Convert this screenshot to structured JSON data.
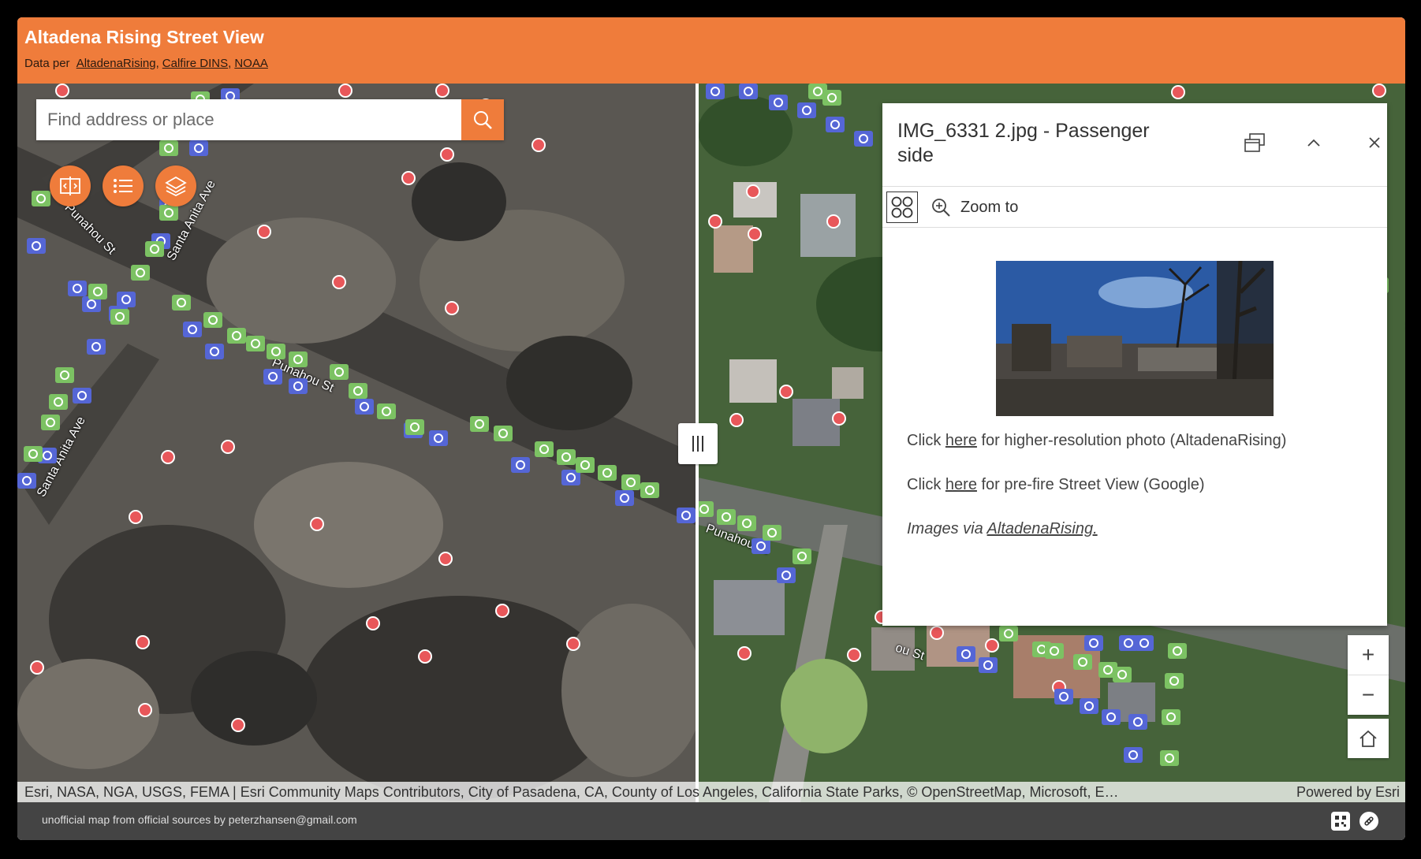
{
  "header": {
    "title": "Altadena Rising Street View",
    "credits_prefix": "Data per",
    "credit_links": [
      "AltadenaRising",
      "Calfire DINS",
      "NOAA"
    ]
  },
  "search": {
    "placeholder": "Find address or place",
    "button_icon": "search-icon"
  },
  "map_tools": [
    {
      "name": "swipe-tool-button",
      "icon": "swipe-icon"
    },
    {
      "name": "legend-button",
      "icon": "list-icon"
    },
    {
      "name": "layers-button",
      "icon": "layers-icon"
    }
  ],
  "road_labels": {
    "punahou_1": "Punahou St",
    "punahou_2": "Punahou St",
    "punahou_3": "Punahou St",
    "punahou_4": "ou St",
    "santa_anita_1": "Santa Anita Ave",
    "santa_anita_2": "Santa Anita Ave",
    "st_edge": "St"
  },
  "popup": {
    "title": "IMG_6331 2.jpg - Passenger side",
    "dock_icon": "dock-icon",
    "collapse_icon": "chevron-up-icon",
    "close_icon": "close-icon",
    "grid_icon": "grid-icon",
    "zoom_to_label": "Zoom to",
    "line1_prefix": "Click",
    "line1_link": "here",
    "line1_suffix": "for higher-resolution photo (AltadenaRising)",
    "line2_prefix": "Click",
    "line2_link": "here",
    "line2_suffix": "for pre-fire Street View (Google)",
    "line3_prefix": "Images via",
    "line3_link": "AltadenaRising."
  },
  "zoom": {
    "in": "+",
    "out": "−",
    "home_icon": "home-icon"
  },
  "attribution": {
    "text": "Esri, NASA, NGA, USGS, FEMA | Esri Community Maps Contributors, City of Pasadena, CA, County of Los Angeles, California State Parks, © OpenStreetMap, Microsoft, Esri, TomTom, Garmin, SafeGraph, GeoTechnologies, Inc, METI/NASA, USGS, Bureau of Land Management, EPA, NPS, US Census Bureau, USDA, USFWS",
    "powered": "Powered by Esri"
  },
  "footer": {
    "text": "unofficial map from official sources by peterzhansen@gmail.com",
    "icons": [
      "qr-code-icon",
      "link-icon"
    ]
  },
  "colors": {
    "accent": "#ef7c3b",
    "footer_bg": "#444444",
    "fire_damage_point": "#e8575a",
    "photo_point_blue": "#5566d6",
    "photo_point_green": "#7cc263"
  }
}
